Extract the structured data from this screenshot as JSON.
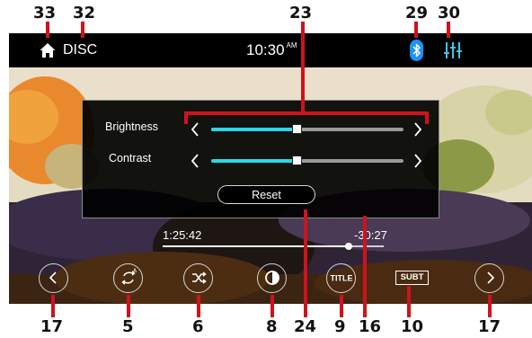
{
  "callouts": {
    "home": "33",
    "source": "32",
    "adjust_panel": "23",
    "bluetooth": "29",
    "equalizer": "30",
    "prev": "17",
    "repeat": "5",
    "shuffle": "6",
    "picture": "8",
    "reset": "24",
    "title": "9",
    "progress": "16",
    "subtitle": "10",
    "next": "17"
  },
  "topbar": {
    "source_label": "DISC",
    "time": "10:30",
    "ampm": "AM",
    "home_icon": "home-icon",
    "bluetooth_icon": "bluetooth-icon",
    "equalizer_icon": "equalizer-icon"
  },
  "adjust_panel": {
    "brightness_label": "Brightness",
    "brightness_level": 0.45,
    "contrast_label": "Contrast",
    "contrast_level": 0.45,
    "reset_label": "Reset"
  },
  "playback": {
    "elapsed": "1:25:42",
    "remaining": "-30:27",
    "progress": 0.84
  },
  "controls": {
    "title_label": "TITLE",
    "subtitle_label": "SUBT"
  },
  "colors": {
    "accent": "#27d9e8",
    "callout_line": "#d0121b",
    "bluetooth": "#1e90ff",
    "eq": "#3ec7e6"
  }
}
